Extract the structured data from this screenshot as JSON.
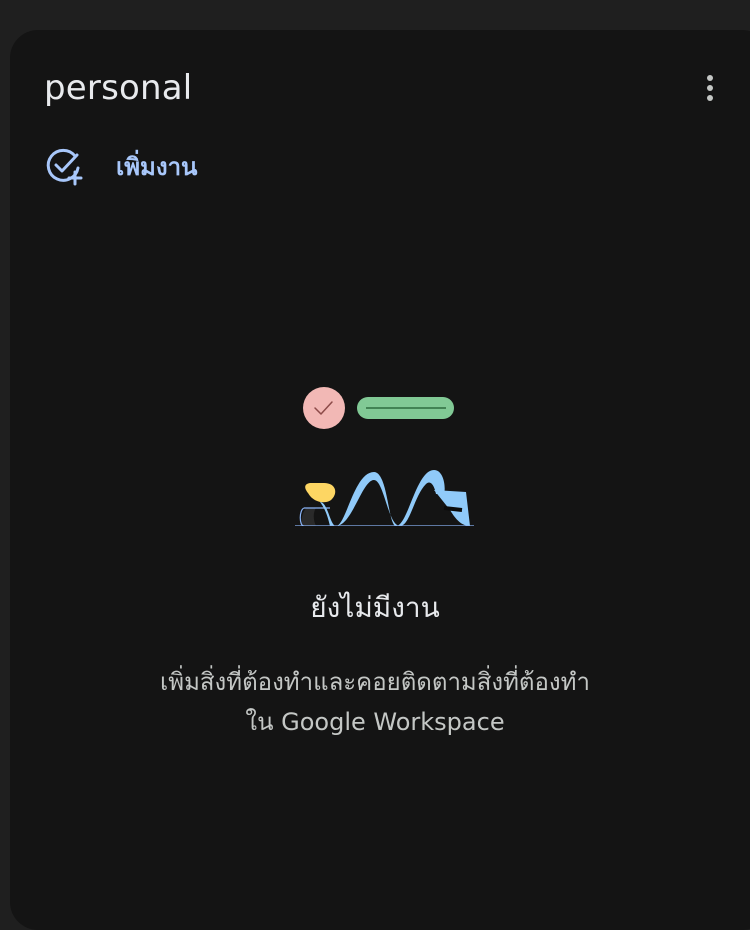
{
  "list": {
    "title": "personal",
    "more_icon": "more-vert-icon"
  },
  "add_task": {
    "label": "เพิ่มงาน",
    "icon": "add-task-icon"
  },
  "empty_state": {
    "title": "ยังไม่มีงาน",
    "description_line1": "เพิ่มสิ่งที่ต้องทำและคอยติดตามสิ่งที่ต้องทำ",
    "description_line2": "ใน Google Workspace"
  },
  "colors": {
    "background": "#1f1f1f",
    "card": "#141414",
    "accent": "#a8c7fa",
    "text_primary": "#e8eaed",
    "text_secondary": "#c4c7c5"
  }
}
